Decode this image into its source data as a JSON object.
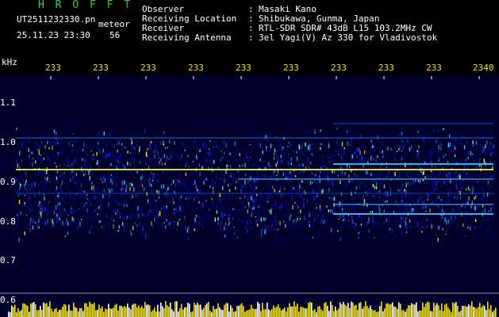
{
  "header": {
    "title": "H R O F F T",
    "filename": "UT2511232330.pn",
    "mode": "meteor",
    "datetime": "25.11.23 23:30",
    "count": "56"
  },
  "info": [
    {
      "label": "Observer",
      "value": "Masaki Kano"
    },
    {
      "label": "Receiving Location",
      "value": "Shibukawa, Gunma, Japan"
    },
    {
      "label": "Receiver",
      "value": "RTL-SDR SDR# 43dB L15 103.2MHz CW"
    },
    {
      "label": "Receiving Antenna",
      "value": "3el Yagi(V) Az 330 for Vladivostok"
    }
  ],
  "chart_data": {
    "type": "heatmap",
    "ylabel": "kHz",
    "x_tick_labels": [
      "233",
      "233",
      "233",
      "233",
      "233",
      "233",
      "233",
      "233",
      "233",
      "2340"
    ],
    "y_tick_labels": [
      "1.1",
      "1.0",
      "0.9",
      "0.8",
      "0.7",
      "0.6"
    ],
    "ylim": [
      0.6,
      1.12
    ],
    "colors": {
      "background": "#000033",
      "tick_x": "#f0e000",
      "signal_low": "#0000aa",
      "signal_mid": "#00aaff",
      "signal_high": "#ffff00"
    }
  }
}
